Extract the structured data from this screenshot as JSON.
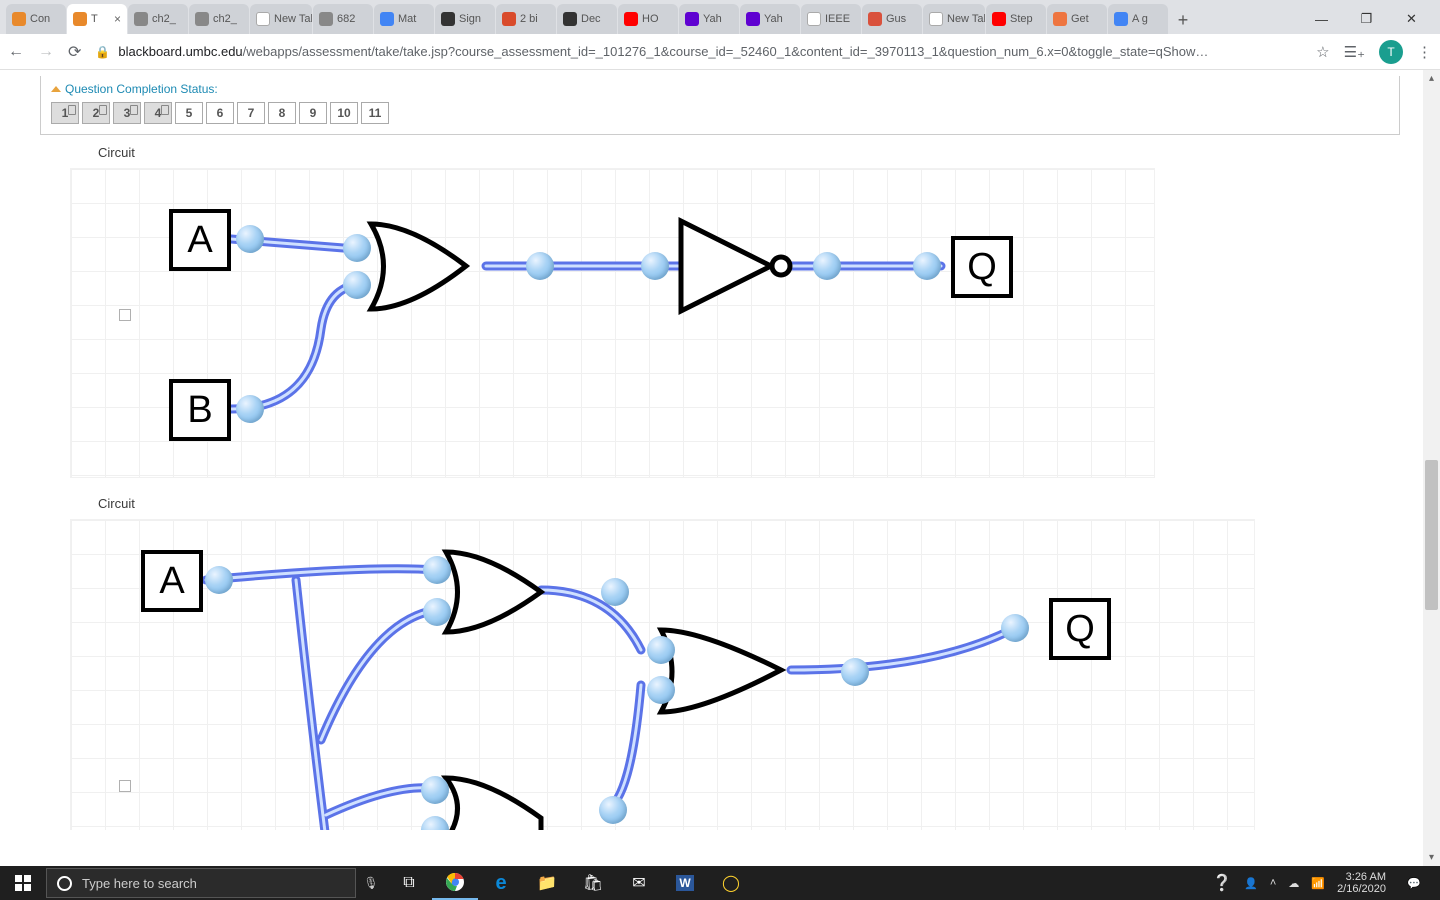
{
  "browser": {
    "tabs": [
      {
        "label": "Con",
        "fav": "#e8892b"
      },
      {
        "label": "T",
        "fav": "#e8892b",
        "close": "×",
        "active": true
      },
      {
        "label": "ch2_",
        "fav": "#888"
      },
      {
        "label": "ch2_",
        "fav": "#888"
      },
      {
        "label": "New Tab",
        "fav": ""
      },
      {
        "label": "682",
        "fav": "#888"
      },
      {
        "label": "Mat",
        "fav": "#4285f4"
      },
      {
        "label": "Sign",
        "fav": "#333"
      },
      {
        "label": "2 bi",
        "fav": "#d94b2b"
      },
      {
        "label": "Dec",
        "fav": "#333"
      },
      {
        "label": "HO",
        "fav": "#ff0000"
      },
      {
        "label": "Yah",
        "fav": "#5f01d1"
      },
      {
        "label": "Yah",
        "fav": "#5f01d1"
      },
      {
        "label": "IEEE",
        "fav": ""
      },
      {
        "label": "Gus",
        "fav": "#d9513c"
      },
      {
        "label": "New Tab",
        "fav": ""
      },
      {
        "label": "Step",
        "fav": "#ff0000"
      },
      {
        "label": "Get",
        "fav": "#ee7540"
      },
      {
        "label": "A g",
        "fav": "#4285f4"
      }
    ],
    "url_host": "blackboard.umbc.edu",
    "url_path": "/webapps/assessment/take/take.jsp?course_assessment_id=_101276_1&course_id=_52460_1&content_id=_3970113_1&question_num_6.x=0&toggle_state=qShow…",
    "avatar": "T"
  },
  "question_status": {
    "label": "Question Completion Status:",
    "items": [
      {
        "n": "1",
        "done": true
      },
      {
        "n": "2",
        "done": true
      },
      {
        "n": "3",
        "done": true
      },
      {
        "n": "4",
        "done": true
      },
      {
        "n": "5",
        "done": false
      },
      {
        "n": "6",
        "done": false
      },
      {
        "n": "7",
        "done": false
      },
      {
        "n": "8",
        "done": false
      },
      {
        "n": "9",
        "done": false
      },
      {
        "n": "10",
        "done": false
      },
      {
        "n": "11",
        "done": false
      }
    ]
  },
  "circuits": {
    "label": "Circuit",
    "c1": {
      "inA": "A",
      "inB": "B",
      "out": "Q"
    },
    "c2": {
      "inA": "A",
      "out": "Q"
    }
  },
  "taskbar": {
    "search_placeholder": "Type here to search",
    "time": "3:26 AM",
    "date": "2/16/2020"
  }
}
